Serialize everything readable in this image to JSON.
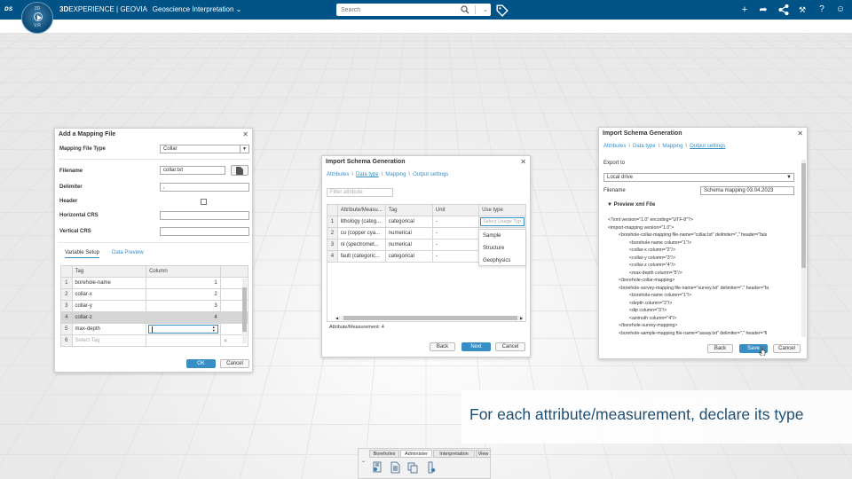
{
  "topbar": {
    "brand_bold": "3D",
    "brand_rest": "EXPERIENCE | GEOVIA",
    "app_name": "Geoscience Interpretation",
    "search_placeholder": "Search",
    "compass_top": "3D",
    "compass_left": "V+R",
    "compass_bottom": "V,R",
    "bg_color": "#005386"
  },
  "mapping_dialog": {
    "title": "Add a Mapping File",
    "type_label": "Mapping File Type",
    "type_value": "Collar",
    "filename_label": "Filename",
    "filename_value": "collar.txt",
    "delimiter_label": "Delimiter",
    "delimiter_value": ",",
    "header_label": "Header",
    "hcrs_label": "Horizontal CRS",
    "vcrs_label": "Vertical CRS",
    "tabs": [
      "Variable Setup",
      "Data Preview"
    ],
    "col_tag": "Tag",
    "col_column": "Column",
    "rows": [
      {
        "n": "1",
        "tag": "borehole-name",
        "col": "1"
      },
      {
        "n": "2",
        "tag": "collar-x",
        "col": "2"
      },
      {
        "n": "3",
        "tag": "collar-y",
        "col": "3"
      },
      {
        "n": "4",
        "tag": "collar-z",
        "col": "4"
      },
      {
        "n": "5",
        "tag": "max-depth",
        "col": ""
      },
      {
        "n": "6",
        "tag": "Select Tag",
        "col": ""
      }
    ],
    "ok": "OK",
    "cancel": "Cancel"
  },
  "schema_dialog_mid": {
    "title": "Import Schema Generation",
    "crumbs": [
      "Attributes",
      "Data type",
      "Mapping",
      "Output settings"
    ],
    "filter_placeholder": "Filter attribute",
    "headers": [
      "Attribute/Measu...",
      "Tag",
      "Unit",
      "Use type"
    ],
    "rows": [
      {
        "n": "1",
        "attr": "lithology (categ...",
        "tag": "categorical",
        "unit": "-",
        "use": "Select Usage Typ"
      },
      {
        "n": "2",
        "attr": "cu (copper cya...",
        "tag": "numerical",
        "unit": "-",
        "use": ""
      },
      {
        "n": "3",
        "attr": "ni (spectromet...",
        "tag": "numerical",
        "unit": "-",
        "use": ""
      },
      {
        "n": "4",
        "attr": "fault (categoric...",
        "tag": "categorical",
        "unit": "-",
        "use": ""
      }
    ],
    "dropdown": [
      "Sample",
      "Structure",
      "Geophysics"
    ],
    "footer": "Attribute/Measurement: 4",
    "back": "Back",
    "next": "Next",
    "cancel": "Cancel"
  },
  "schema_dialog_right": {
    "title": "Import Schema Generation",
    "crumbs": [
      "Attributes",
      "Data type",
      "Mapping",
      "Output settings"
    ],
    "export_label": "Export to",
    "export_value": "Local drive",
    "filename_label": "Filename",
    "filename_value": "Schema mapping 03.04.2023",
    "preview_label": "Preview xml File",
    "xml_lines": [
      "<?xml version=\"1.0\" encoding=\"UTF-8\"?>",
      "<import-mapping version=\"1.0\">",
      "<borehole-collar-mapping file-name=\"collar.txt\" delimiter=\",\" header=\"fals",
      "<borehole-name column=\"1\"/>",
      "<collar-x column=\"2\"/>",
      "<collar-y column=\"3\"/>",
      "<collar-z column=\"4\"/>",
      "<max-depth column=\"5\"/>",
      "</borehole-collar-mapping>",
      "<borehole-survey-mapping file-name=\"survey.txt\" delimiter=\",\" header=\"fa",
      "<borehole-name column=\"1\"/>",
      "<depth column=\"2\"/>",
      "<dip column=\"3\"/>",
      "<azimuth column=\"4\"/>",
      "</borehole-survey-mapping>",
      "<borehole-sample-mapping file-name=\"assay.txt\" delimiter=\",\" header=\"fi"
    ],
    "back": "Back",
    "save": "Save",
    "cancel": "Cancel"
  },
  "caption": "For each attribute/measurement, declare its type",
  "bottom_tabs": [
    "Boreholes",
    "Administer",
    "Interpretation",
    "View"
  ],
  "accent": "#368ec4"
}
